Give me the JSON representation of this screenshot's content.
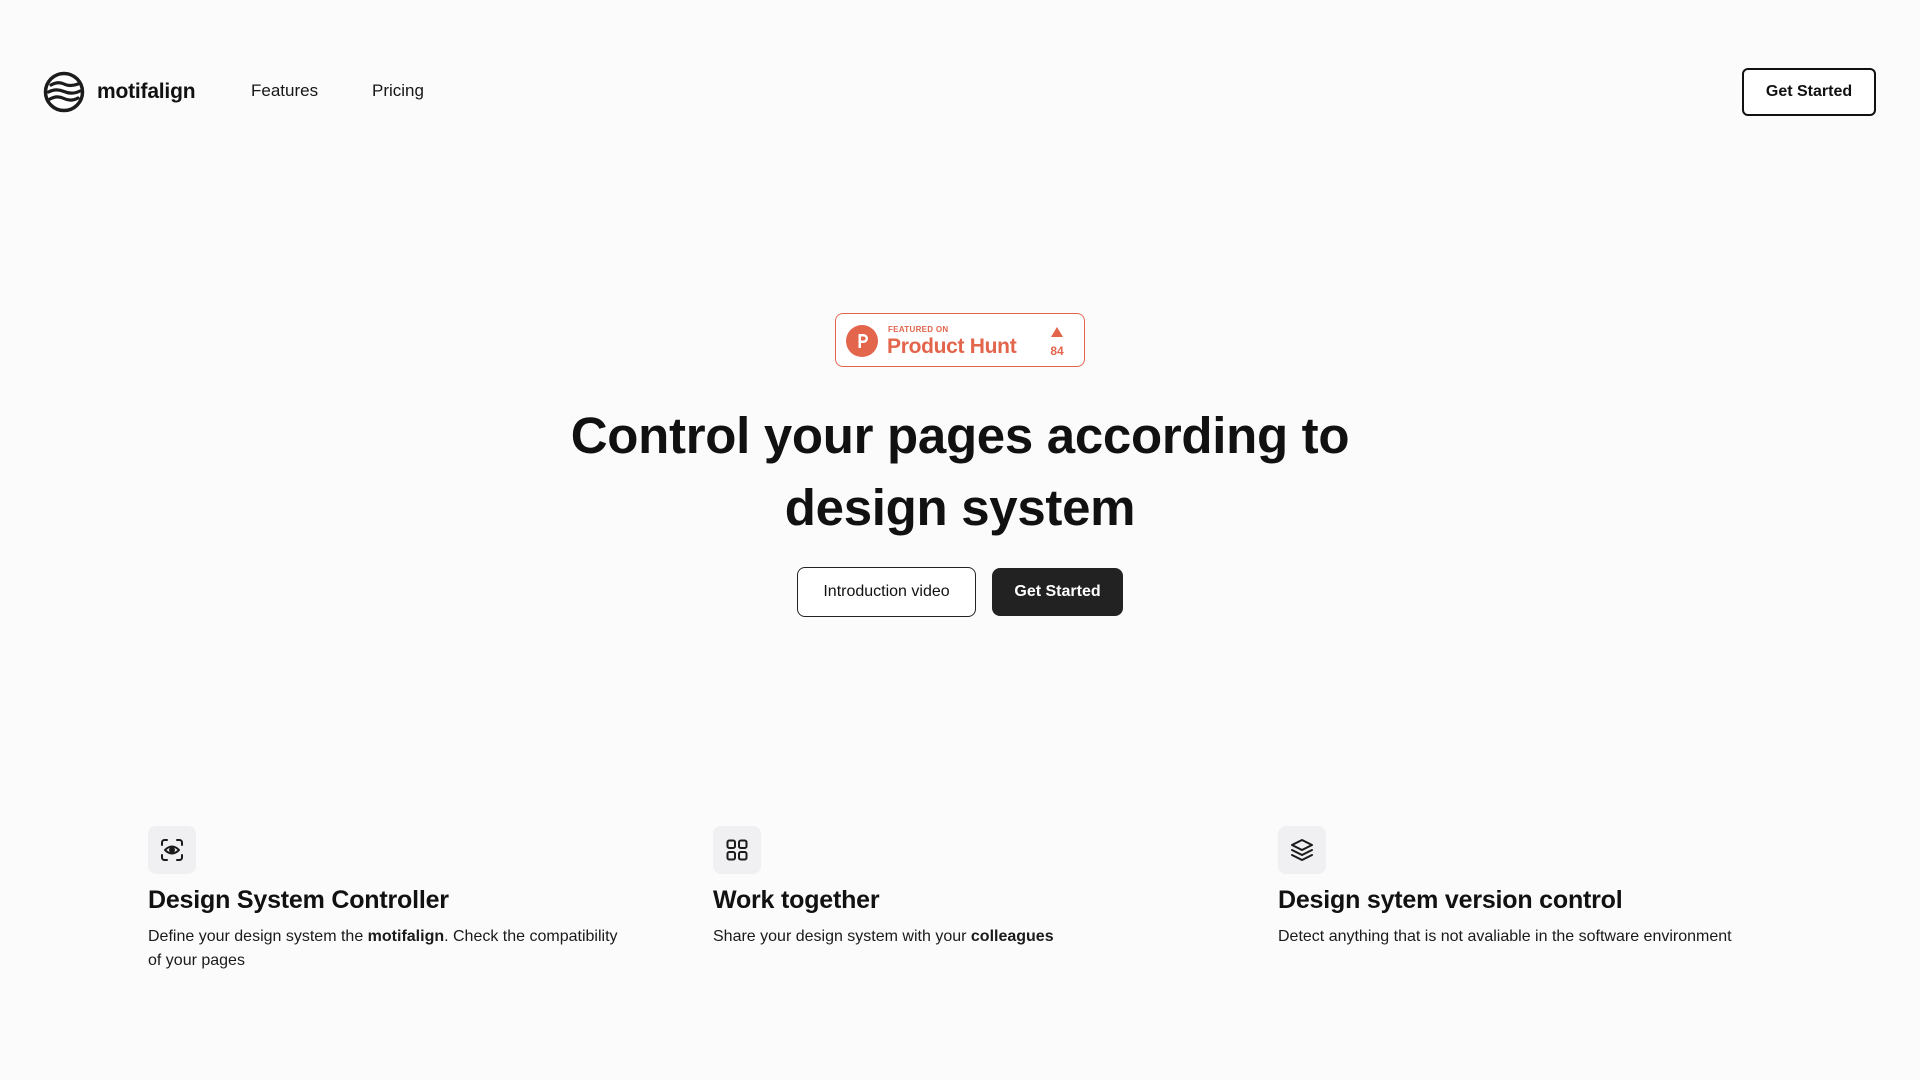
{
  "nav": {
    "brand": "motifalign",
    "links": [
      "Features",
      "Pricing"
    ],
    "cta": "Get Started"
  },
  "badge": {
    "featured_on": "FEATURED ON",
    "name": "Product Hunt",
    "votes": "84",
    "color": "#e2654c"
  },
  "hero": {
    "title_line1": "Control your pages according to",
    "title_line2": "design system",
    "secondary_button": "Introduction video",
    "primary_button": "Get Started"
  },
  "features": [
    {
      "icon": "eye-scan-icon",
      "title": "Design System Controller",
      "desc_before": "Define your design system the ",
      "desc_bold": "motifalign",
      "desc_after": ". Check the compatibility of your pages"
    },
    {
      "icon": "grid-icon",
      "title": "Work together",
      "desc_before": "Share your design system with your ",
      "desc_bold": "colleagues",
      "desc_after": ""
    },
    {
      "icon": "layers-icon",
      "title": "Design sytem version control",
      "desc_before": "Detect anything that is not avaliable in the software environment",
      "desc_bold": "",
      "desc_after": ""
    }
  ]
}
